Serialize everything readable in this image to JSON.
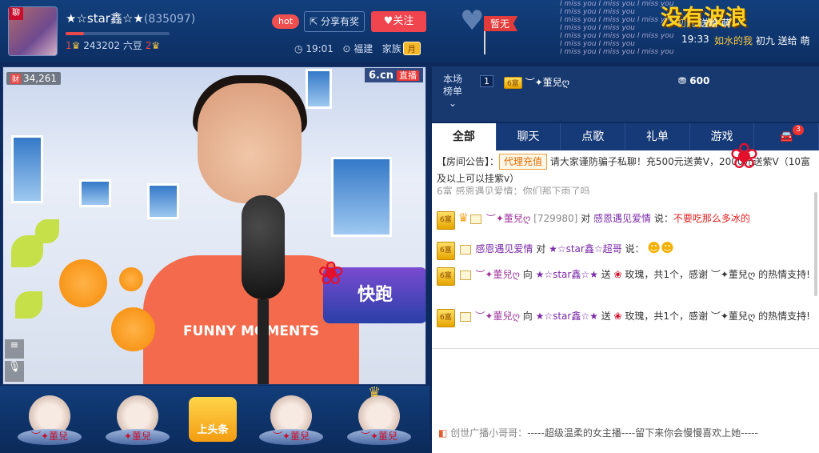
{
  "header": {
    "host_name": "★☆star鑫☆★",
    "host_id": "(835097)",
    "avatar_tag": "聊",
    "level_from": "1",
    "level_to": "2",
    "beans_text": "243202 六豆",
    "hot_label": "hot",
    "share_label": "分享有奖",
    "follow_label": "关注",
    "time": "19:01",
    "location": "福建",
    "family_label": "家族",
    "month_badge": "月"
  },
  "top_banner": {
    "none_label": "暂无",
    "title": "没有波浪",
    "gift_lines": [
      {
        "time": "",
        "user": "初九",
        "action": "送给 萌"
      },
      {
        "time": "19:33",
        "user": "如水的我",
        "action": "初九 送给 萌"
      }
    ],
    "missyou_text": "I miss you"
  },
  "video": {
    "viewer_tag": "财",
    "viewer_count": "34,261",
    "site_logo": "6.cn",
    "live_label": "直播",
    "shirt_text": "FUNNY MOMENTS",
    "sign_text": "快跑"
  },
  "seats": [
    {
      "name": "︶✦董兒"
    },
    {
      "name": "✦董兒"
    },
    {
      "name": "︶✦董兒"
    },
    {
      "name": "︶✦董兒"
    }
  ],
  "seat_center_label": "上头条",
  "rank": {
    "label_line1": "本场",
    "label_line2": "榜单",
    "position": "1",
    "level": "6富",
    "user": "︶✦董兒ღ",
    "score": "600"
  },
  "tabs": [
    {
      "label": "全部",
      "active": true
    },
    {
      "label": "聊天"
    },
    {
      "label": "点歌"
    },
    {
      "label": "礼单"
    },
    {
      "label": "游戏"
    },
    {
      "label": "",
      "count": "3"
    }
  ],
  "chat": {
    "notice_prefix": "【房间公告】：",
    "notice_tag": "代理充值",
    "notice_text": "请大家谨防骗子私聊！充500元送黄V，2000元送紫V（10富及以上可以挂紫v）",
    "partial_line": "6富  感恩遇见爱情：你们那下雨了吗",
    "messages": [
      {
        "level": "6富",
        "user": "︶✦董兒ღ",
        "uid": "[729980]",
        "verb": "对",
        "target": "感恩遇见爱情",
        "said": "说：",
        "text": "不要吃那么多冰的"
      },
      {
        "level": "6富",
        "user": "感恩遇见爱情",
        "verb": "对",
        "target": "★☆star鑫☆超哥",
        "said": "说：",
        "text": ""
      },
      {
        "level": "6富",
        "user": "︶✦董兒ღ",
        "verb": "向",
        "target": "★☆star鑫☆★",
        "said": "送",
        "text": "玫瑰，共1个，感谢 ︶✦董兒ღ 的热情支持!"
      },
      {
        "level": "6富",
        "user": "︶✦董兒ღ",
        "verb": "向",
        "target": "★☆star鑫☆★",
        "said": "送",
        "text": "玫瑰，共1个，感谢 ︶✦董兒ღ 的热情支持!"
      }
    ]
  },
  "broadcast": {
    "source": "创世广播小哥哥：",
    "text": "-----超级温柔的女主播----留下来你会慢慢喜欢上她-----"
  },
  "colors": {
    "accent": "#f0444e",
    "header_bg": "#123f7c",
    "banner_yellow": "#ffd21f"
  }
}
